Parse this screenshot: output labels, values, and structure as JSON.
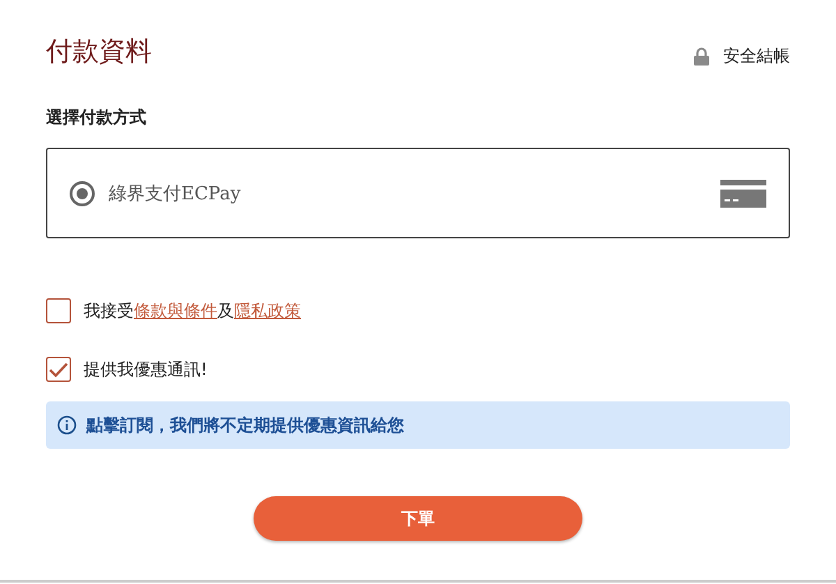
{
  "title": "付款資料",
  "secure_label": "安全結帳",
  "section_label": "選擇付款方式",
  "payment_methods": [
    {
      "label": "綠界支付ECPay",
      "selected": true
    }
  ],
  "checkboxes": [
    {
      "checked": false,
      "parts": [
        {
          "kind": "text",
          "text": "我接受"
        },
        {
          "kind": "link",
          "text": "條款與條件"
        },
        {
          "kind": "text",
          "text": "及"
        },
        {
          "kind": "link",
          "text": "隱私政策"
        }
      ]
    },
    {
      "checked": true,
      "parts": [
        {
          "kind": "text",
          "text": "提供我優惠通訊!"
        }
      ]
    }
  ],
  "info_banner": "點擊訂閱，我們將不定期提供優惠資訊給您",
  "submit_button": "下單"
}
